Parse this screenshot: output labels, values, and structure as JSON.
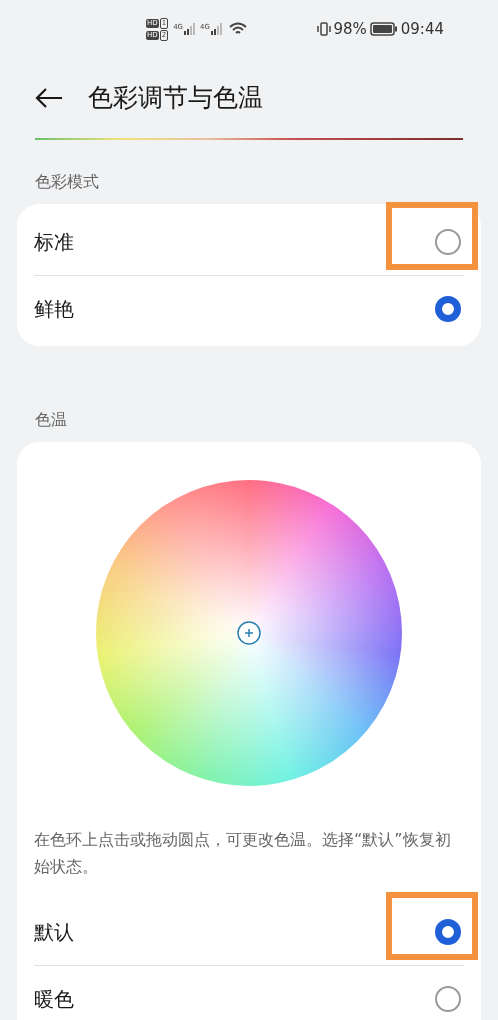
{
  "status_bar": {
    "sims": [
      {
        "badge": "HD",
        "slot": "1",
        "network": "4G"
      },
      {
        "badge": "HD",
        "slot": "2",
        "network": "4G"
      }
    ],
    "battery": "98%",
    "time": "09:44"
  },
  "header": {
    "title": "色彩调节与色温"
  },
  "sections": [
    {
      "title": "色彩模式",
      "options": [
        {
          "label": "标准",
          "selected": false,
          "highlighted": true
        },
        {
          "label": "鲜艳",
          "selected": true,
          "highlighted": false
        }
      ]
    },
    {
      "title": "色温",
      "description": "在色环上点击或拖动圆点，可更改色温。选择“默认”恢复初始状态。",
      "options": [
        {
          "label": "默认",
          "selected": true,
          "highlighted": true
        },
        {
          "label": "暖色",
          "selected": false,
          "highlighted": false
        }
      ]
    }
  ]
}
